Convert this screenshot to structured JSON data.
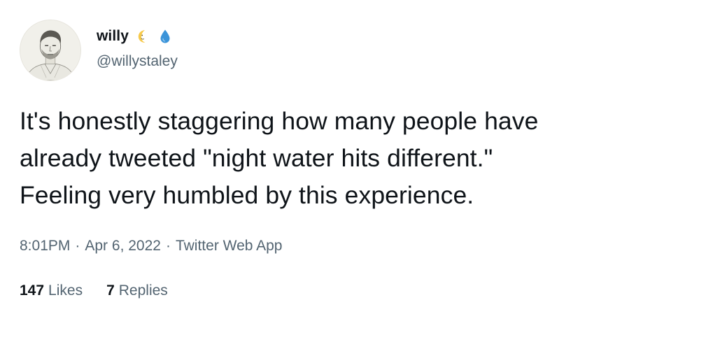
{
  "author": {
    "display_name": "willy",
    "handle": "@willystaley",
    "emojis": [
      "crescent-moon-face-icon",
      "droplet-icon"
    ]
  },
  "tweet": {
    "text": "It's honestly staggering how many people have\nalready tweeted \"night water hits different.\"\nFeeling very humbled by this experience."
  },
  "meta": {
    "time": "8:01PM",
    "separator": "·",
    "date": "Apr 6, 2022",
    "source": "Twitter Web App"
  },
  "stats": {
    "likes_count": "147",
    "likes_label": "Likes",
    "replies_count": "7",
    "replies_label": "Replies"
  },
  "colors": {
    "text_primary": "#0f1419",
    "text_secondary": "#536471",
    "moon": "#f6c94a",
    "droplet": "#3b94d9"
  }
}
